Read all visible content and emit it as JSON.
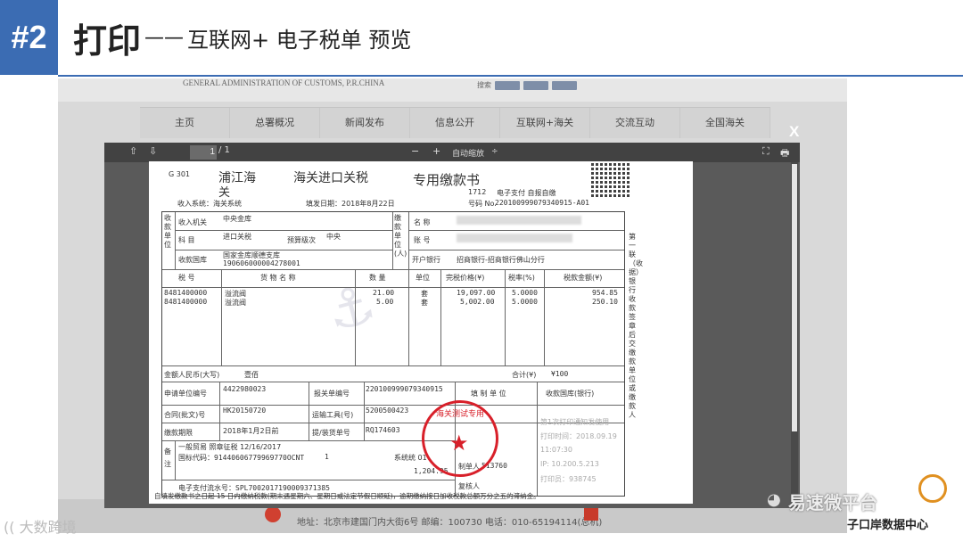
{
  "slide": {
    "badge": "#2",
    "title": "打印",
    "title_dash": "——",
    "subtitle": "互联网+ 电子税单 预览"
  },
  "site": {
    "org_name": "GENERAL ADMINISTRATION OF CUSTOMS, P.R.CHINA",
    "search_label": "搜索",
    "nav": [
      "主页",
      "总署概况",
      "新闻发布",
      "信息公开",
      "互联网+海关",
      "交流互动",
      "全国海关"
    ],
    "footer_address": "地址：北京市建国门内大街6号 邮编：100730 电话：010-65194114(总机)"
  },
  "viewer": {
    "up_arrow": "⇧",
    "down_arrow": "⇩",
    "page_value": "1",
    "page_total": "/ 1",
    "zoom_out": "−",
    "zoom_in": "+",
    "zoom_label": "自动缩放",
    "zoom_caret": "÷",
    "fullscreen_icon": "⛶",
    "print_icon": "🖶",
    "close_label": "X"
  },
  "doc": {
    "form_code": "G 301",
    "customs_name": "浦江海",
    "customs_name_2": "关",
    "title_a": "海关进口关税",
    "title_b": "专用缴款书",
    "system_line": "收入系统：海关系统",
    "issue_date": "填发日期：2018年8月22日",
    "code_1712": "1712",
    "payment_type": "电子支付 自报自缴",
    "number_label": "号码 No.",
    "number": "220100999079340915-A01",
    "receiver_block": "收款单位",
    "payer_block": "缴款单位(人)",
    "receiving_office_label": "收入机关",
    "receiving_office": "中央金库",
    "subject_label": "科 目",
    "subject": "进口关税",
    "budget_level_label": "预算级次",
    "budget_level": "中央",
    "treasury_label": "收款国库",
    "treasury": "国家金库顺德支库",
    "treasury_code": "190606000004278001",
    "payer_name_label": "名 称",
    "payer_account_label": "账 号",
    "payer_bank_label": "开户银行",
    "payer_bank": "招商银行-招商银行佛山分行",
    "col_tax_no": "税 号",
    "col_goods": "货 物 名 称",
    "col_qty": "数 量",
    "col_unit": "单位",
    "col_price": "完税价格(¥)",
    "col_rate": "税率(%)",
    "col_tax_amount": "税款金额(¥)",
    "rows": [
      {
        "tax_no": "8481400000",
        "goods": "溢流阀",
        "qty": "21.00",
        "unit": "套",
        "price": "19,097.00",
        "rate": "5.0000",
        "amount": "954.85"
      },
      {
        "tax_no": "8481400000",
        "goods": "溢流阀",
        "qty": "5.00",
        "unit": "套",
        "price": "5,002.00",
        "rate": "5.0000",
        "amount": "250.10"
      }
    ],
    "amount_rmb_label": "金额人民币(大写)",
    "amount_rmb": "壹佰",
    "total_label": "合计(¥)",
    "total": "¥100",
    "applicant_code_label": "申请单位编号",
    "applicant_code": "4422980023",
    "declaration_no_label": "报关单编号",
    "declaration_no": "220100999079340915",
    "issuer_label": "填 制 单 位",
    "treasury_bank_label": "收款国库(银行)",
    "contract_label": "合同(批文)号",
    "contract": "HK20150720",
    "transport_label": "运输工具(号)",
    "transport": "5200500423",
    "deadline_label": "缴款期限",
    "deadline": "2018年1月2日前",
    "bill_label": "提/装货单号",
    "bill": "RQ174603",
    "remarks_label": "备注",
    "remarks_1": "一般贸易 照章征税 12/16/2017",
    "remarks_2": "国标代码：91440606779969770OCNT",
    "remarks_2b": "1",
    "remarks_sys": "系统统 01",
    "remarks_amount": "1,204.95",
    "maker_label": "制单人",
    "maker_code": "513760",
    "reviewer_label": "复核人",
    "e_pay_no": "电子支付流水号：SPL7002017190009371385",
    "treasury_notes": [
      "第1次打印通知发使用",
      "打印时间：2018.09.19",
      "11:07:30",
      "IP: 10.200.5.213",
      "打印员：938745"
    ],
    "stamp_text": "海关测试专用",
    "footer_note": "自填发缴款书之日起 15 日内缴纳税款(期末遇星期六、星期日或法定节假日顺延)，逾期缴纳按日加收税款总额万分之五的滞纳金。",
    "side_text": "第一联（收据）银行收款签章后交缴款单位或缴款人"
  },
  "watermarks": {
    "left": "(( 大数跨境",
    "right": "易速微平台",
    "brand": "子口岸数据中心"
  }
}
